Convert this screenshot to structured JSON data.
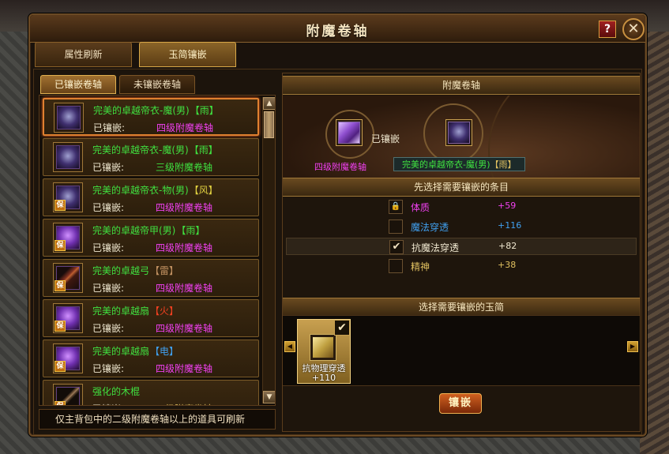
{
  "window": {
    "title": "附魔卷轴",
    "help": "?",
    "close": "✕"
  },
  "tabs": [
    {
      "label": "属性刷新"
    },
    {
      "label": "玉简镶嵌"
    }
  ],
  "subtabs": [
    {
      "label": "已镶嵌卷轴"
    },
    {
      "label": "未镶嵌卷轴"
    }
  ],
  "list": {
    "items": [
      {
        "name": "完美的卓越帝衣-魔(男)",
        "element": "【雨】",
        "element_color": "#40e040",
        "stat_label": "已镶嵌:",
        "stat_value": "四级附魔卷轴",
        "stat_color": "#f040f0",
        "icon": "armor",
        "tag": ""
      },
      {
        "name": "完美的卓越帝衣-魔(男)",
        "element": "【雨】",
        "element_color": "#40e040",
        "stat_label": "已镶嵌:",
        "stat_value": "三级附魔卷轴",
        "stat_color": "#40e040",
        "icon": "armor",
        "tag": ""
      },
      {
        "name": "完美的卓越帝衣-物(男)",
        "element": "【风】",
        "element_color": "#e0d040",
        "stat_label": "已镶嵌:",
        "stat_value": "四级附魔卷轴",
        "stat_color": "#f040f0",
        "icon": "armor",
        "tag": "保"
      },
      {
        "name": "完美的卓越帝甲(男)",
        "element": "【雨】",
        "element_color": "#40e040",
        "stat_label": "已镶嵌:",
        "stat_value": "四级附魔卷轴",
        "stat_color": "#f040f0",
        "icon": "fan",
        "tag": "保"
      },
      {
        "name": "完美的卓越弓",
        "element": "【雷】",
        "element_color": "#c09060",
        "stat_label": "已镶嵌:",
        "stat_value": "四级附魔卷轴",
        "stat_color": "#f040f0",
        "icon": "bow",
        "tag": "保"
      },
      {
        "name": "完美的卓越扇",
        "element": "【火】",
        "element_color": "#f04020",
        "stat_label": "已镶嵌:",
        "stat_value": "四级附魔卷轴",
        "stat_color": "#f040f0",
        "icon": "fan",
        "tag": "保"
      },
      {
        "name": "完美的卓越扇",
        "element": "【电】",
        "element_color": "#40a0f0",
        "stat_label": "已镶嵌:",
        "stat_value": "四级附魔卷轴",
        "stat_color": "#f040f0",
        "icon": "fan",
        "tag": "保"
      },
      {
        "name": "强化的木棍",
        "element": "",
        "element_color": "#40e040",
        "stat_label": "已镶嵌:",
        "stat_value": "二级附魔卷轴",
        "stat_color": "#e0c060",
        "icon": "stick",
        "tag": "保"
      }
    ]
  },
  "hint": "仅主背包中的二级附魔卷轴以上的道具可刷新",
  "right": {
    "header": "附魔卷轴",
    "scroll_label": "四级附魔卷轴",
    "embedded": "已镶嵌",
    "target_name": "完美的卓越帝衣-魔(男)",
    "target_element": "【雨】",
    "select_attr_header": "先选择需要镶嵌的条目",
    "attributes": [
      {
        "name": "体质",
        "value": "+59",
        "color": "#f040f0",
        "check": "🔒",
        "state": "locked"
      },
      {
        "name": "魔法穿透",
        "value": "+116",
        "color": "#40a0f0",
        "check": "",
        "state": "unchecked"
      },
      {
        "name": "抗魔法穿透",
        "value": "+82",
        "color": "#f0e8d0",
        "check": "✔",
        "state": "checked"
      },
      {
        "name": "精神",
        "value": "+38",
        "color": "#e0c060",
        "check": "",
        "state": "unchecked"
      }
    ],
    "select_jade_header": "选择需要镶嵌的玉简",
    "jade": {
      "name_line1": "抗物理穿透",
      "name_line2": "+110",
      "check": "✔"
    },
    "embed_button": "镶嵌"
  }
}
